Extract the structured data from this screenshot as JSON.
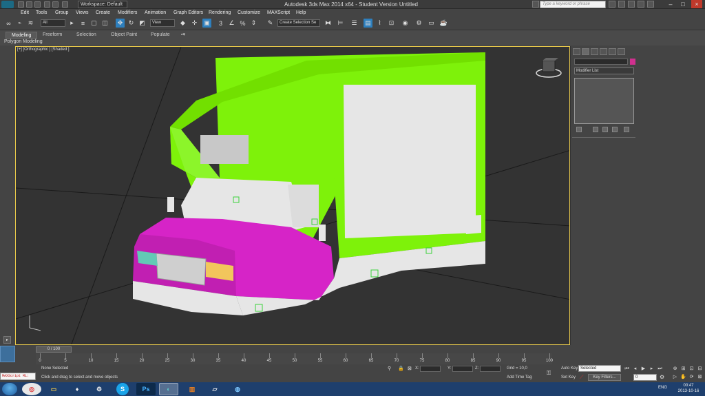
{
  "titlebar": {
    "workspace": "Workspace: Default",
    "title": "Autodesk 3ds Max  2014 x64  - Student Version    Untitled",
    "search_placeholder": "Type a keyword or phrase"
  },
  "menu": [
    "Edit",
    "Tools",
    "Group",
    "Views",
    "Create",
    "Modifiers",
    "Animation",
    "Graph Editors",
    "Rendering",
    "Customize",
    "MAXScript",
    "Help"
  ],
  "toolbar": {
    "filter_select": "All",
    "coord_select": "View",
    "selection_set": "Create Selection Se"
  },
  "ribbon": {
    "tabs": [
      "Modeling",
      "Freeform",
      "Selection",
      "Object Paint",
      "Populate"
    ],
    "sub_label": "Polygon Modeling"
  },
  "viewport": {
    "label": "[+] [Orthographic ] [Shaded ]",
    "colors": {
      "body": "#7ef20a",
      "hood": "#d624c7",
      "panel": "#e6e6e6",
      "grid": "#1a1a1a",
      "border": "#e8c94a"
    }
  },
  "command_panel": {
    "modifier_list": "Modifier List"
  },
  "timeline": {
    "frame_label": "0 / 100",
    "ticks": [
      "0",
      "5",
      "10",
      "15",
      "20",
      "25",
      "30",
      "35",
      "40",
      "45",
      "50",
      "55",
      "60",
      "65",
      "70",
      "75",
      "80",
      "85",
      "90",
      "95",
      "100"
    ]
  },
  "status": {
    "maxscript": "MAXScript Mi:",
    "selection": "None Selected",
    "prompt": "Click and drag to select and move objects",
    "x_label": "X:",
    "y_label": "Y:",
    "z_label": "Z:",
    "grid": "Grid = 10,0",
    "add_time_tag": "Add Time Tag"
  },
  "animation": {
    "auto_key": "Auto Key",
    "set_key": "Set Key",
    "selected": "Selected",
    "key_filters": "Key Filters...",
    "frame": "0"
  },
  "taskbar": {
    "language": "ENG",
    "time": "00:47",
    "date": "2013-10-16"
  }
}
